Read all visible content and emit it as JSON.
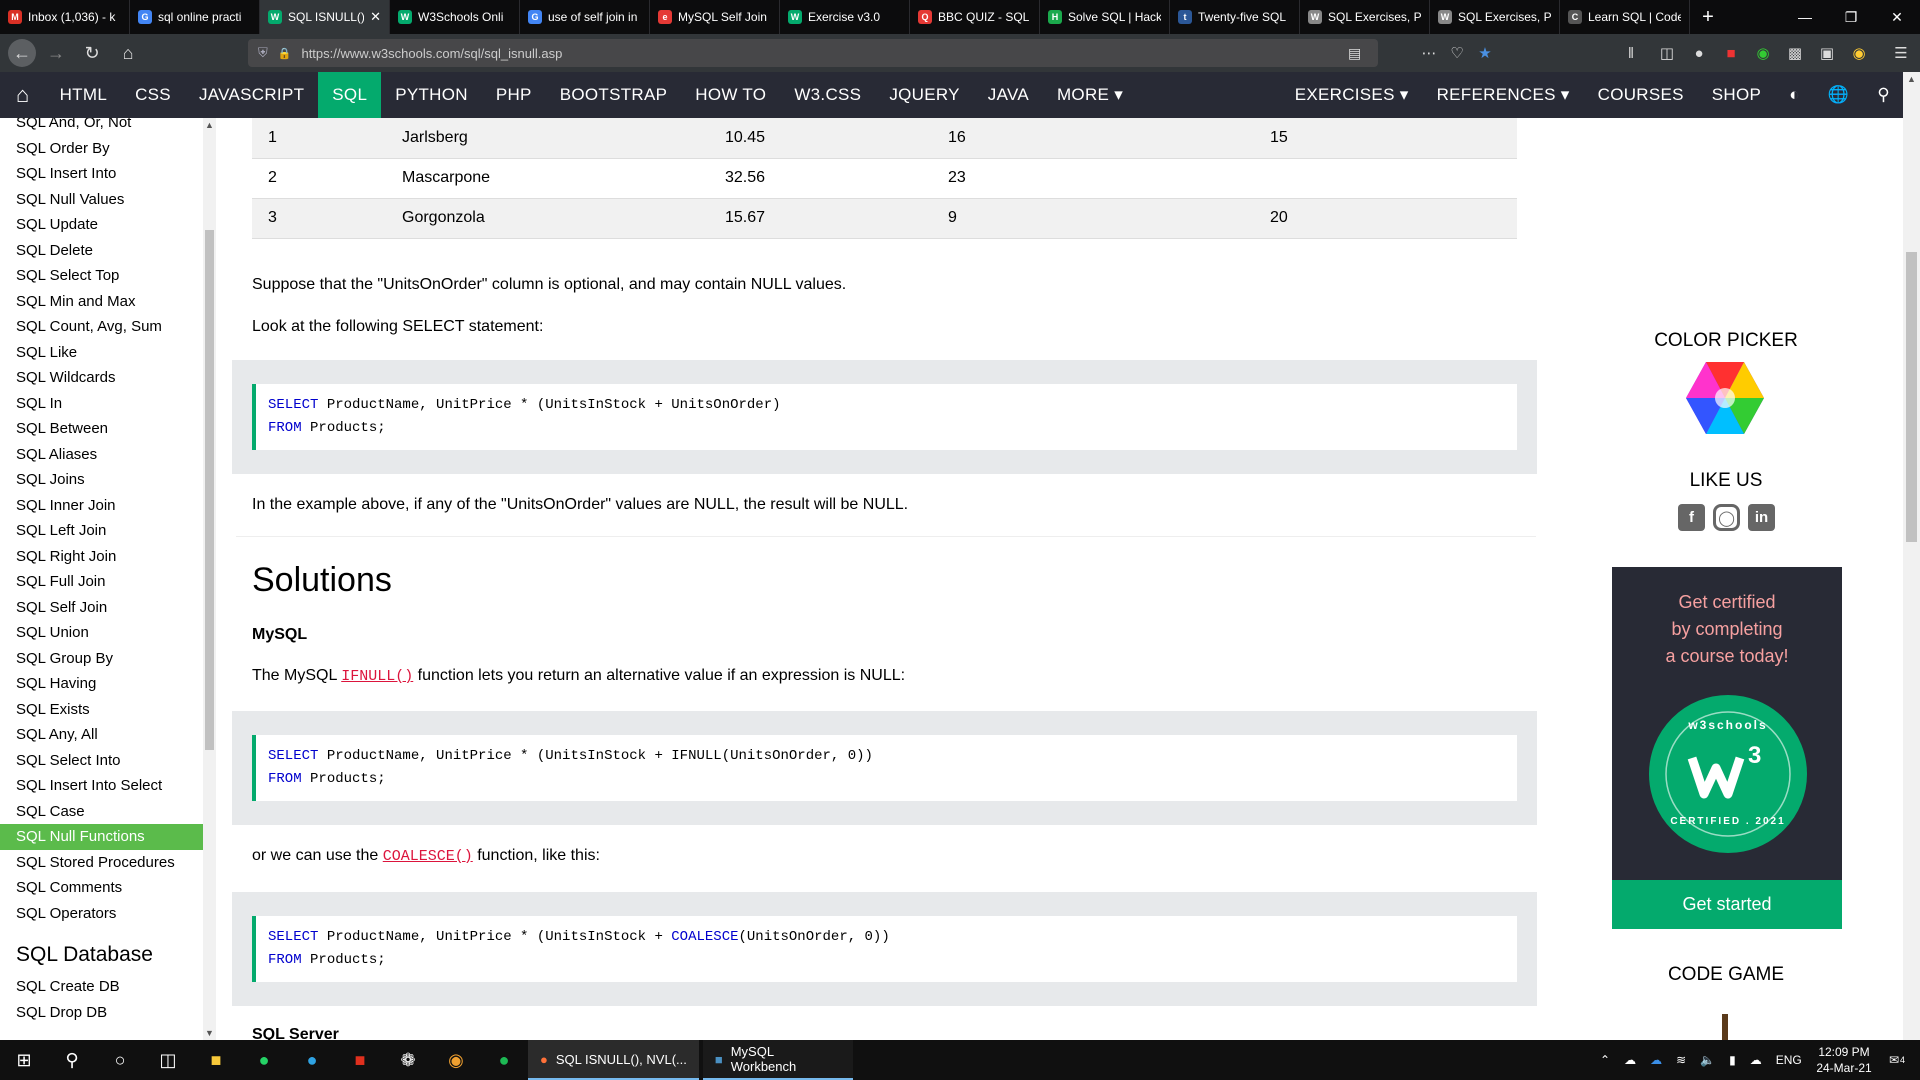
{
  "tabs": [
    {
      "label": "Inbox (1,036) - k",
      "icon": "gmail-icon",
      "color": "#d93025",
      "glyph": "M"
    },
    {
      "label": "sql online practi",
      "icon": "google-icon",
      "color": "#4285f4",
      "glyph": "G"
    },
    {
      "label": "SQL ISNULL(), ",
      "icon": "w3schools-icon",
      "color": "#04aa6d",
      "glyph": "W",
      "active": true
    },
    {
      "label": "W3Schools Onli",
      "icon": "w3schools-icon",
      "color": "#04aa6d",
      "glyph": "W"
    },
    {
      "label": "use of self join in",
      "icon": "google-icon",
      "color": "#4285f4",
      "glyph": "G"
    },
    {
      "label": "MySQL Self Join",
      "icon": "mysqltutorial-icon",
      "color": "#e53935",
      "glyph": "e"
    },
    {
      "label": "Exercise v3.0",
      "icon": "w3schools-icon",
      "color": "#04aa6d",
      "glyph": "W"
    },
    {
      "label": "BBC QUIZ - SQL",
      "icon": "quiz-icon",
      "color": "#e53935",
      "glyph": "Q"
    },
    {
      "label": "Solve SQL | Hack",
      "icon": "hackerrank-icon",
      "color": "#1ba94c",
      "glyph": "H"
    },
    {
      "label": "Twenty-five SQL",
      "icon": "site-icon",
      "color": "#2b5797",
      "glyph": "t"
    },
    {
      "label": "SQL Exercises, Pr",
      "icon": "w3resource-icon",
      "color": "#888888",
      "glyph": "W"
    },
    {
      "label": "SQL Exercises, Pr",
      "icon": "w3resource-icon",
      "color": "#888888",
      "glyph": "W"
    },
    {
      "label": "Learn SQL | Code",
      "icon": "codecademy-icon",
      "color": "#555555",
      "glyph": "C"
    }
  ],
  "browser": {
    "url": "https://www.w3schools.com/sql/sql_isnull.asp"
  },
  "topnav": {
    "items": [
      "HTML",
      "CSS",
      "JAVASCRIPT",
      "SQL",
      "PYTHON",
      "PHP",
      "BOOTSTRAP",
      "HOW TO",
      "W3.CSS",
      "JQUERY",
      "JAVA",
      "MORE ▾"
    ],
    "right_items": [
      "EXERCISES ▾",
      "REFERENCES ▾",
      "COURSES",
      "SHOP"
    ]
  },
  "sidebar": {
    "items": [
      "SQL And, Or, Not",
      "SQL Order By",
      "SQL Insert Into",
      "SQL Null Values",
      "SQL Update",
      "SQL Delete",
      "SQL Select Top",
      "SQL Min and Max",
      "SQL Count, Avg, Sum",
      "SQL Like",
      "SQL Wildcards",
      "SQL In",
      "SQL Between",
      "SQL Aliases",
      "SQL Joins",
      "SQL Inner Join",
      "SQL Left Join",
      "SQL Right Join",
      "SQL Full Join",
      "SQL Self Join",
      "SQL Union",
      "SQL Group By",
      "SQL Having",
      "SQL Exists",
      "SQL Any, All",
      "SQL Select Into",
      "SQL Insert Into Select",
      "SQL Case",
      "SQL Null Functions",
      "SQL Stored Procedures",
      "SQL Comments",
      "SQL Operators"
    ],
    "active_index": 28,
    "section_heading": "SQL Database",
    "section_items": [
      "SQL Create DB",
      "SQL Drop DB"
    ]
  },
  "table": {
    "rows": [
      [
        "1",
        "Jarlsberg",
        "10.45",
        "16",
        "15"
      ],
      [
        "2",
        "Mascarpone",
        "32.56",
        "23",
        ""
      ],
      [
        "3",
        "Gorgonzola",
        "15.67",
        "9",
        "20"
      ]
    ]
  },
  "content": {
    "p1": "Suppose that the \"UnitsOnOrder\" column is optional, and may contain NULL values.",
    "p2": "Look at the following SELECT statement:",
    "code1_l1_kw": "SELECT",
    "code1_l1": " ProductName, UnitPrice * (UnitsInStock + UnitsOnOrder)",
    "code1_l2_kw": "FROM",
    "code1_l2": " Products;",
    "p3": "In the example above, if any of the \"UnitsOnOrder\" values are NULL, the result will be NULL.",
    "h2": "Solutions",
    "h3_mysql": "MySQL",
    "p4_a": "The MySQL ",
    "p4_code": "IFNULL()",
    "p4_b": " function lets you return an alternative value if an expression is NULL:",
    "code2_l1_kw": "SELECT",
    "code2_l1": " ProductName, UnitPrice * (UnitsInStock + IFNULL(UnitsOnOrder, 0))",
    "code2_l2_kw": "FROM",
    "code2_l2": " Products;",
    "p5_a": "or we can use the ",
    "p5_code": "COALESCE()",
    "p5_b": " function, like this:",
    "code3_l1_kw": "SELECT",
    "code3_l1a": " ProductName, UnitPrice * (UnitsInStock + ",
    "code3_l1_fn": "COALESCE",
    "code3_l1b": "(UnitsOnOrder, 0))",
    "code3_l2_kw": "FROM",
    "code3_l2": " Products;",
    "h3_sqlserver": "SQL Server"
  },
  "right": {
    "color_picker": "COLOR PICKER",
    "like_us": "LIKE US",
    "promo_line1": "Get certified",
    "promo_line2": "by completing",
    "promo_line3": "a course today!",
    "badge_top": "w3schools",
    "badge_bottom": "CERTIFIED . 2021",
    "promo_button": "Get started",
    "code_game": "CODE GAME"
  },
  "taskbar": {
    "apps": [
      "SQL ISNULL(), NVL(...",
      "MySQL Workbench"
    ],
    "lang": "ENG",
    "time": "12:09 PM",
    "date": "24-Mar-21",
    "notification_count": "4"
  },
  "colors": {
    "w3_green": "#04aa6d",
    "nav_dark": "#282a35",
    "sidebar_active": "#5bbb4b"
  }
}
